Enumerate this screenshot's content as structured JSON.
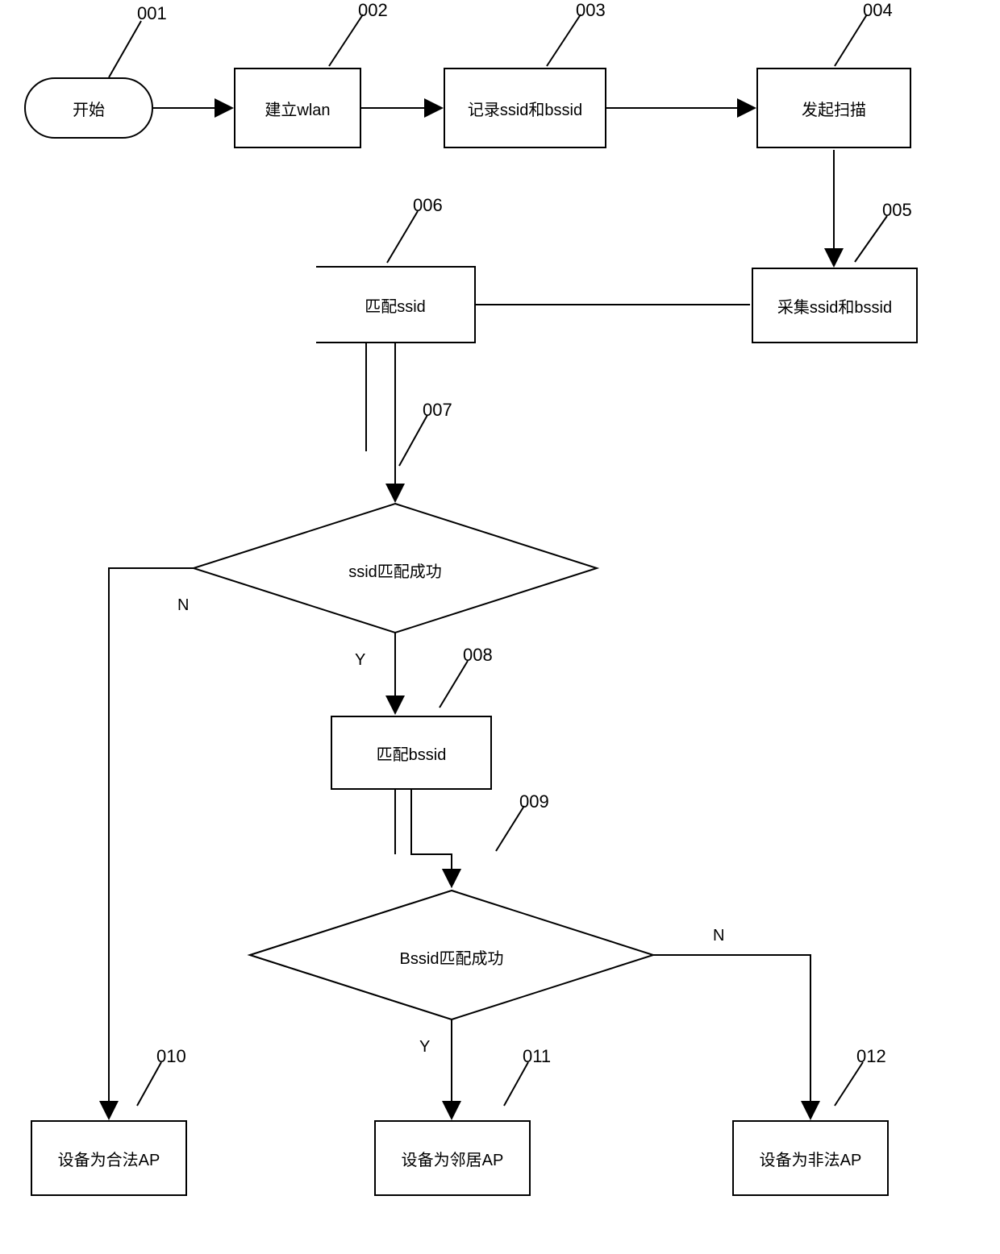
{
  "nodes": {
    "n001": {
      "id": "001",
      "label": "开始"
    },
    "n002": {
      "id": "002",
      "label": "建立wlan"
    },
    "n003": {
      "id": "003",
      "label": "记录ssid和bssid"
    },
    "n004": {
      "id": "004",
      "label": "发起扫描"
    },
    "n005": {
      "id": "005",
      "label": "采集ssid和bssid"
    },
    "n006": {
      "id": "006",
      "label": "匹配ssid"
    },
    "n007": {
      "id": "007",
      "label": "ssid匹配成功"
    },
    "n008": {
      "id": "008",
      "label": "匹配bssid"
    },
    "n009": {
      "id": "009",
      "label": "Bssid匹配成功"
    },
    "n010": {
      "id": "010",
      "label": "设备为合法AP"
    },
    "n011": {
      "id": "011",
      "label": "设备为邻居AP"
    },
    "n012": {
      "id": "012",
      "label": "设备为非法AP"
    }
  },
  "edgeLabels": {
    "Y1": "Y",
    "N1": "N",
    "Y2": "Y",
    "N2": "N"
  }
}
